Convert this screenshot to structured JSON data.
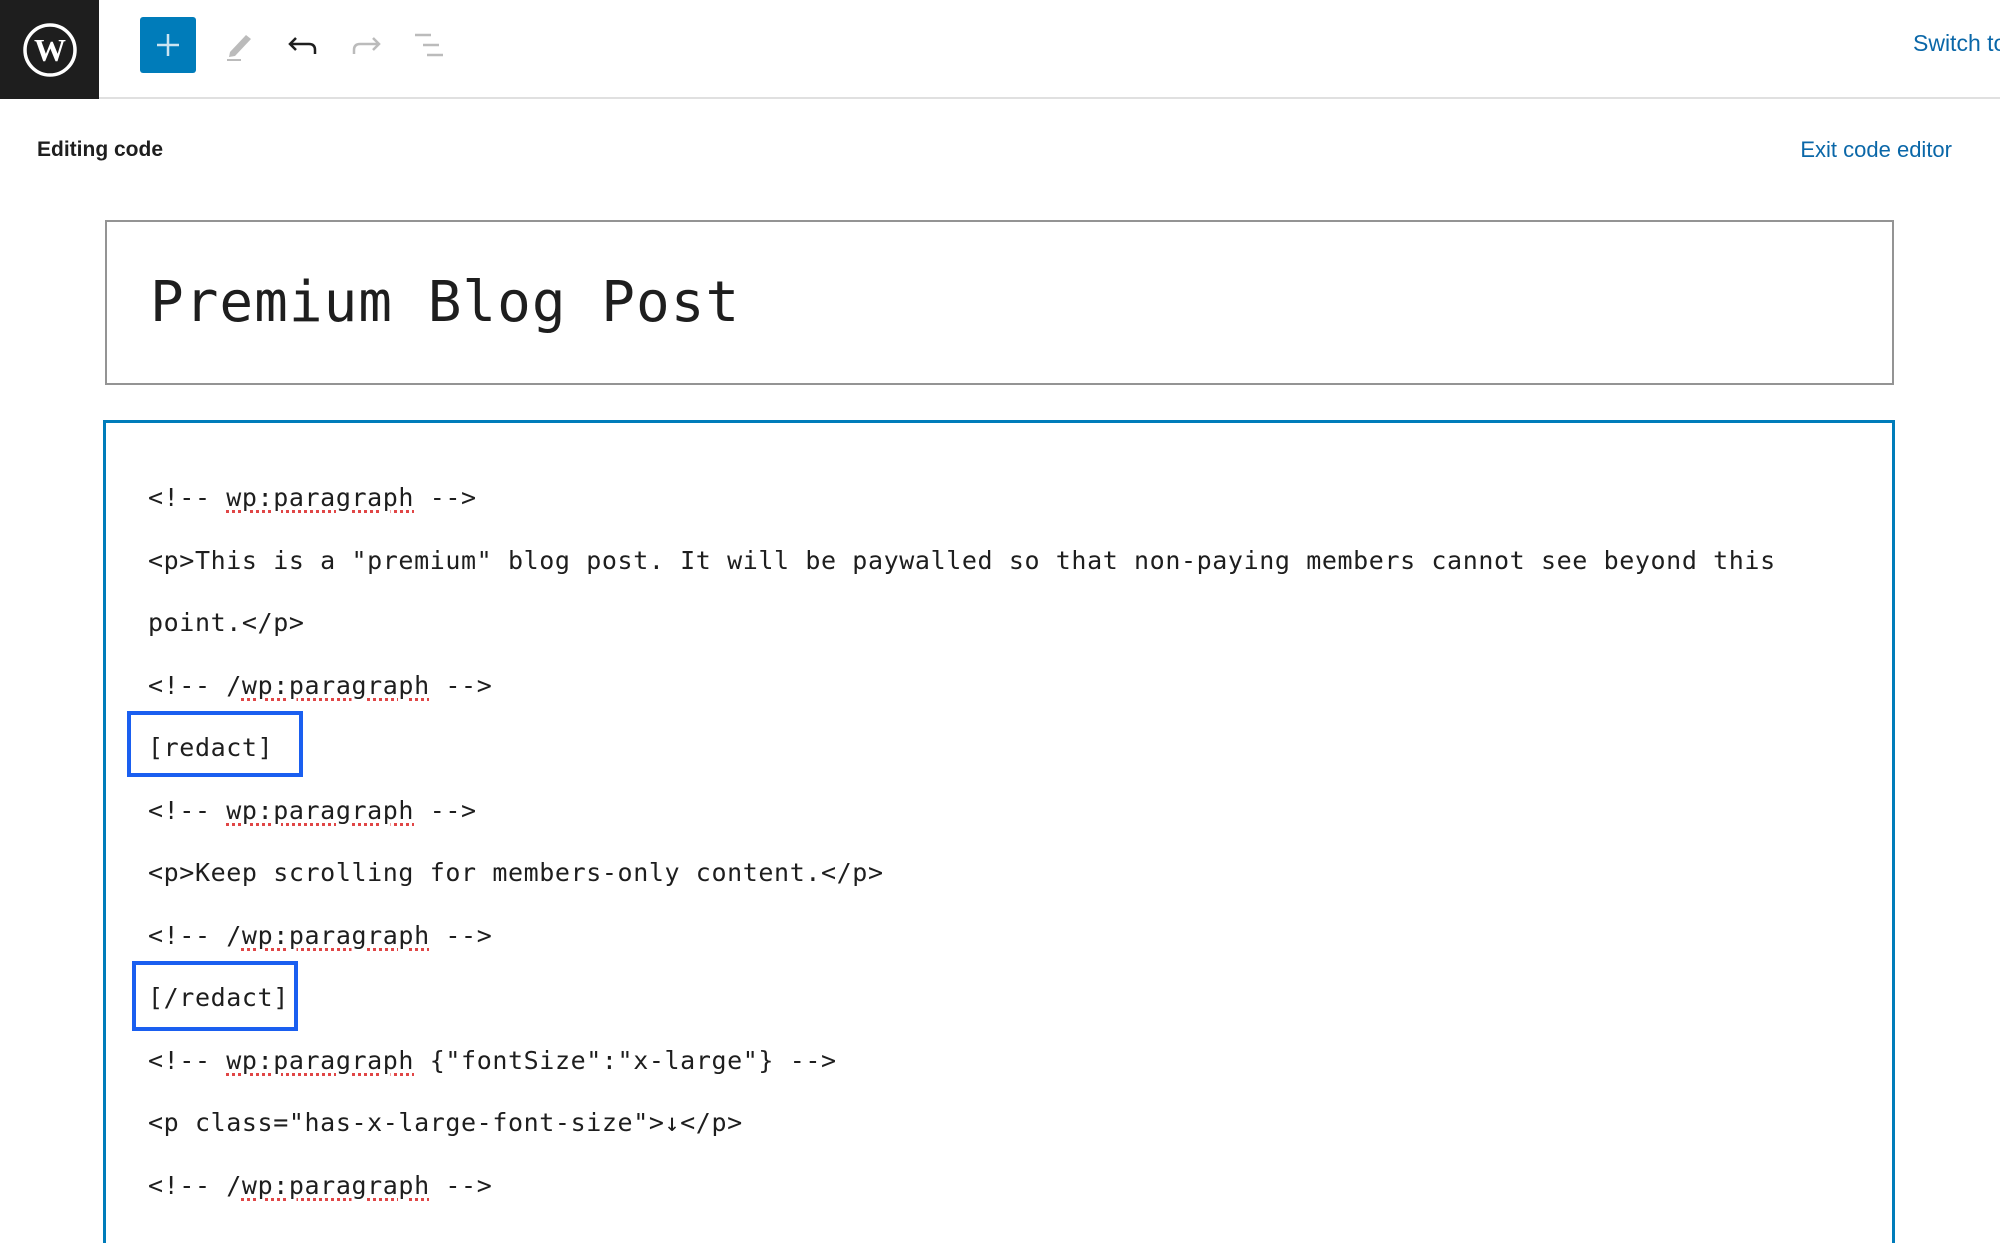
{
  "topbar": {
    "logo": "wordpress-logo",
    "add_block_label": "+",
    "tools": [
      {
        "name": "add-block",
        "icon": "plus-icon",
        "enabled": true
      },
      {
        "name": "tools",
        "icon": "pencil-icon",
        "enabled": false
      },
      {
        "name": "undo",
        "icon": "undo-icon",
        "enabled": true
      },
      {
        "name": "redo",
        "icon": "redo-icon",
        "enabled": false
      },
      {
        "name": "document-overview",
        "icon": "list-view-icon",
        "enabled": false
      }
    ],
    "switch_link": "Switch to"
  },
  "header": {
    "editing_label": "Editing code",
    "exit_label": "Exit code editor"
  },
  "editor": {
    "title": "Premium Blog Post",
    "lines": [
      {
        "pre": "<!-- ",
        "word": "wp:paragraph",
        "post": " -->"
      },
      {
        "pre": "<p>This is a \"premium\" blog post. It will be paywalled so that non-paying members cannot see beyond this",
        "word": "",
        "post": ""
      },
      {
        "pre": "point.</p>",
        "word": "",
        "post": ""
      },
      {
        "pre": "<!-- /",
        "word": "wp:paragraph",
        "post": " -->"
      },
      {
        "pre": "[redact]",
        "word": "",
        "post": ""
      },
      {
        "pre": "<!-- ",
        "word": "wp:paragraph",
        "post": " -->"
      },
      {
        "pre": "<p>Keep scrolling for members-only content.</p>",
        "word": "",
        "post": ""
      },
      {
        "pre": "<!-- /",
        "word": "wp:paragraph",
        "post": " -->"
      },
      {
        "pre": "[/redact]",
        "word": "",
        "post": ""
      },
      {
        "pre": "<!-- ",
        "word": "wp:paragraph",
        "post": " {\"fontSize\":\"x-large\"} -->"
      },
      {
        "pre": "<p class=\"has-x-large-font-size\">↓</p>",
        "word": "",
        "post": ""
      },
      {
        "pre": "<!-- /",
        "word": "wp:paragraph",
        "post": " -->"
      }
    ]
  },
  "colors": {
    "accent": "#007cba",
    "highlight_box": "#1a5ff0",
    "link": "#0a67a8",
    "logo_bg": "#1e1e1e"
  }
}
